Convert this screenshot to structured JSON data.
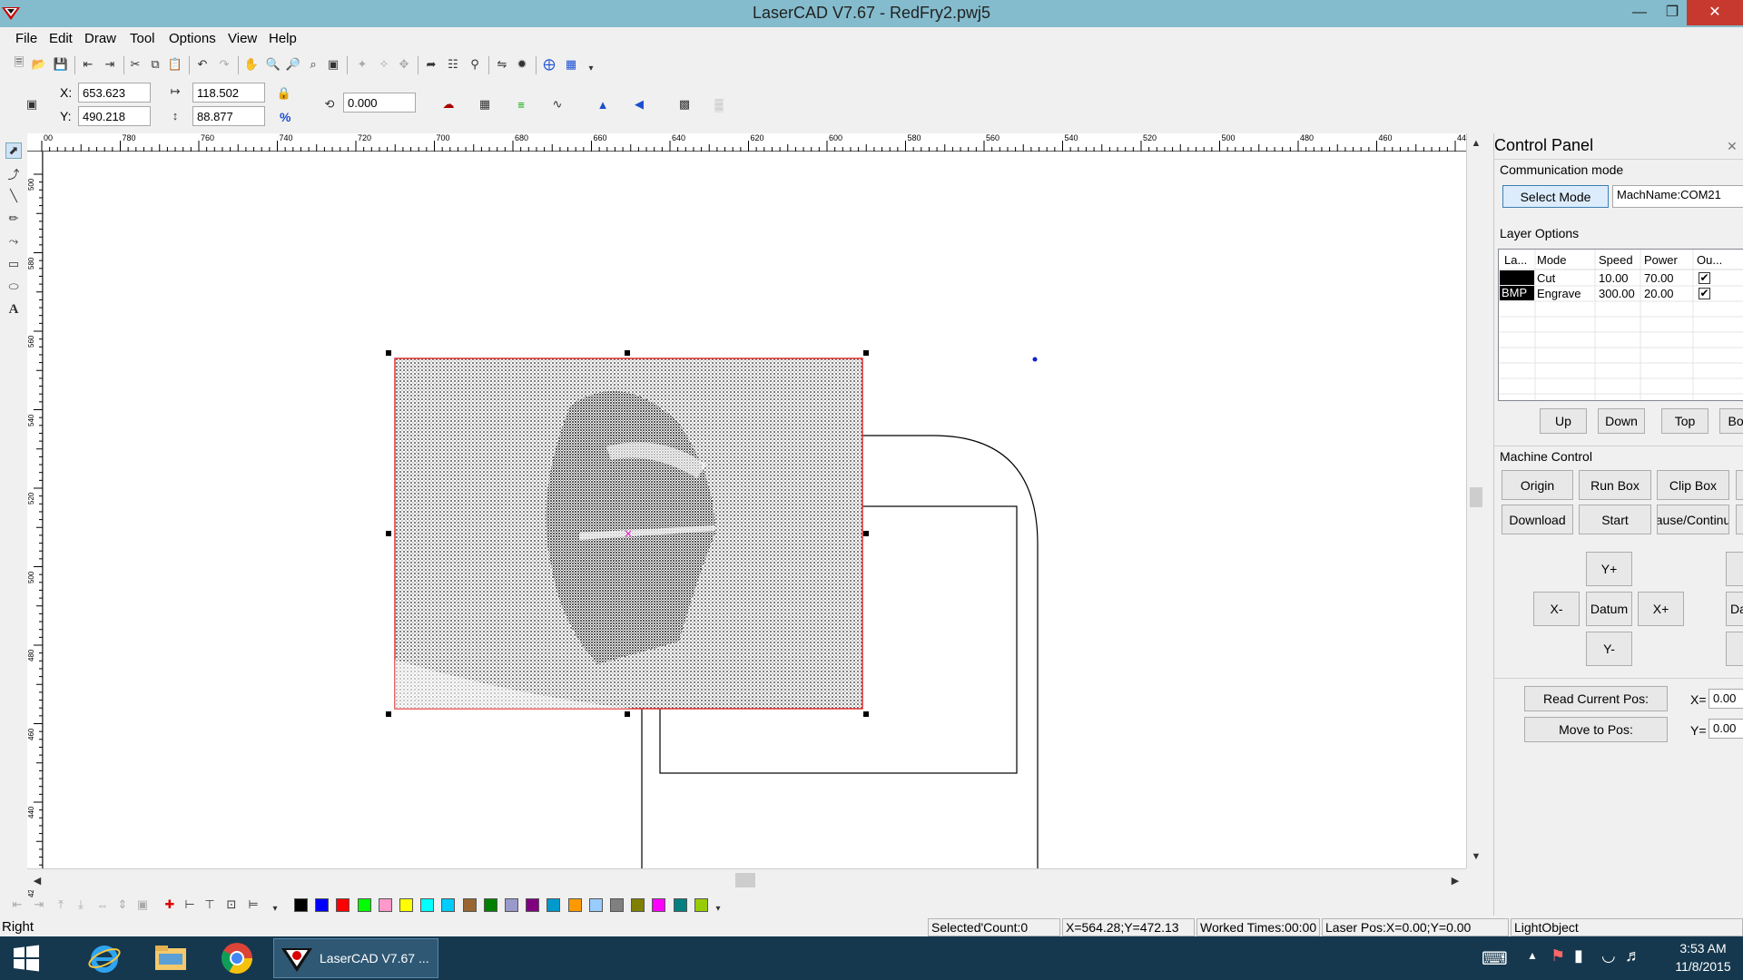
{
  "window": {
    "title": "LaserCAD V7.67 - RedFry2.pwj5"
  },
  "menu": {
    "file": "File",
    "edit": "Edit",
    "draw": "Draw",
    "tool": "Tool",
    "options": "Options",
    "view": "View",
    "help": "Help"
  },
  "props": {
    "x_label": "X:",
    "x_value": "653.623",
    "y_label": "Y:",
    "y_value": "490.218",
    "width_value": "118.502",
    "height_value": "88.877",
    "percent_symbol": "%",
    "rotate_value": "0.000"
  },
  "ruler": {
    "h_ticks": [
      "00",
      "780",
      "760",
      "740",
      "720",
      "700",
      "680",
      "660",
      "640",
      "620",
      "600",
      "580",
      "560",
      "540",
      "520",
      "500",
      "480",
      "460",
      "44"
    ],
    "v_ticks": [
      "500",
      "580",
      "560",
      "540",
      "520",
      "500",
      "480",
      "460",
      "440",
      "420"
    ]
  },
  "palette_colors": [
    "#000000",
    "#0000ff",
    "#ff0000",
    "#00ff00",
    "#ff99cc",
    "#ffff00",
    "#00ffff",
    "#00ccff",
    "#996633",
    "#008000",
    "#9999cc",
    "#800080",
    "#0099cc",
    "#ff9900",
    "#99ccff",
    "#808080",
    "#808000",
    "#ff00ff",
    "#008080",
    "#99cc00"
  ],
  "status": {
    "left": "Right",
    "selected_count": "Selected'Count:0",
    "cursor": "X=564.28;Y=472.13",
    "worked_times": "Worked Times:00:00",
    "laser_pos": "Laser Pos:X=0.00;Y=0.00",
    "mode": "LightObject"
  },
  "control_panel": {
    "title": "Control Panel",
    "communication_mode_label": "Communication mode",
    "select_mode_button": "Select Mode",
    "mach_name": "MachName:COM21",
    "layer_options_label": "Layer Options",
    "layer_columns": [
      "La...",
      "Mode",
      "Speed",
      "Power",
      "Ou..."
    ],
    "layers": [
      {
        "name": "",
        "mode": "Cut",
        "speed": "10.00",
        "power": "70.00",
        "output": "✔"
      },
      {
        "name": "BMP",
        "mode": "Engrave",
        "speed": "300.00",
        "power": "20.00",
        "output": "✔"
      }
    ],
    "layer_buttons": {
      "up": "Up",
      "down": "Down",
      "top": "Top",
      "bottom": "Bot"
    },
    "machine_control_label": "Machine Control",
    "machine_buttons": {
      "origin": "Origin",
      "run_box": "Run Box",
      "clip_box": "Clip Box",
      "download": "Download",
      "start": "Start",
      "pause": "ause/Continu"
    },
    "jog": {
      "y_plus": "Y+",
      "y_minus": "Y-",
      "x_minus": "X-",
      "x_plus": "X+",
      "datum": "Datum",
      "right_partial": "Da"
    },
    "read_pos_button": "Read Current Pos:",
    "move_to_pos_button": "Move to Pos:",
    "x_label": "X=",
    "x_value": "0.00",
    "y_label": "Y=",
    "y_value": "0.00"
  },
  "taskbar": {
    "app_label": "LaserCAD V7.67 ...",
    "time": "3:53 AM",
    "date": "11/8/2015"
  }
}
